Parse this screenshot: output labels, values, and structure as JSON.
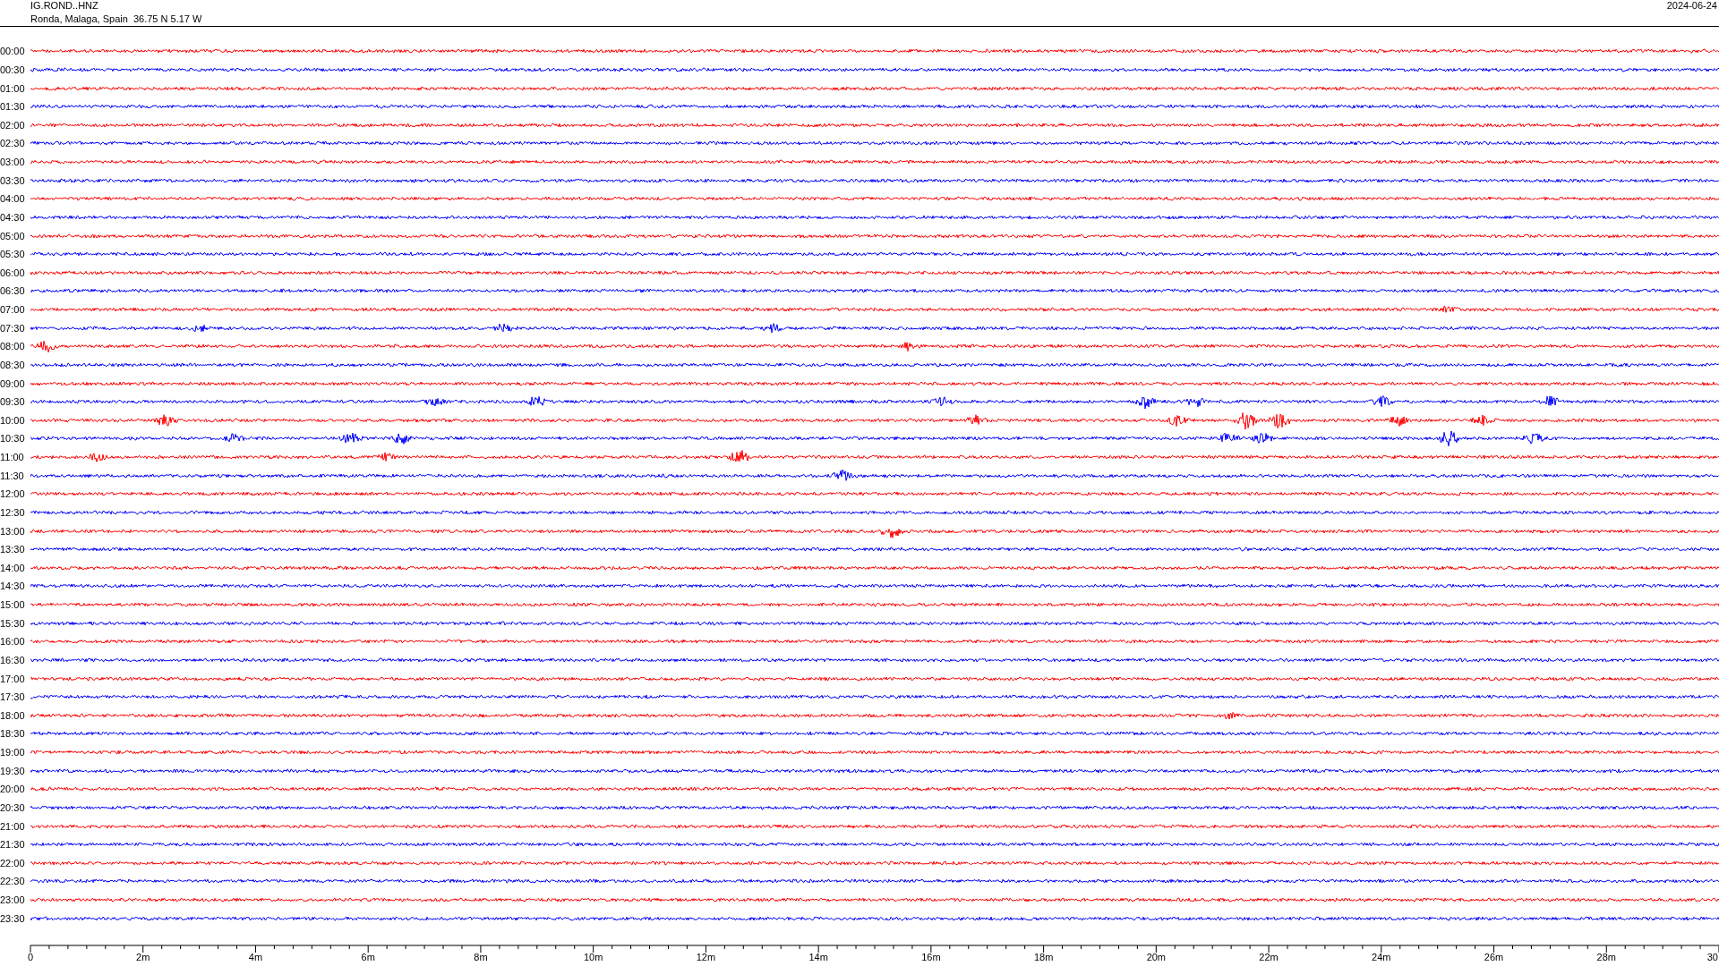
{
  "header": {
    "station": "IG.ROND..HNZ",
    "location": "Ronda, Malaga, Spain  36.75 N 5.17 W",
    "date": "2024-06-24"
  },
  "traces": [
    {
      "time": "00:00",
      "color": "#ff0000"
    },
    {
      "time": "00:30",
      "color": "#0000ff"
    },
    {
      "time": "01:00",
      "color": "#ff0000"
    },
    {
      "time": "01:30",
      "color": "#0000ff"
    },
    {
      "time": "02:00",
      "color": "#ff0000"
    },
    {
      "time": "02:30",
      "color": "#0000ff"
    },
    {
      "time": "03:00",
      "color": "#ff0000"
    },
    {
      "time": "03:30",
      "color": "#0000ff"
    },
    {
      "time": "04:00",
      "color": "#ff0000"
    },
    {
      "time": "04:30",
      "color": "#0000ff"
    },
    {
      "time": "05:00",
      "color": "#ff0000"
    },
    {
      "time": "05:30",
      "color": "#0000ff"
    },
    {
      "time": "06:00",
      "color": "#ff0000"
    },
    {
      "time": "06:30",
      "color": "#0000ff"
    },
    {
      "time": "07:00",
      "color": "#ff0000"
    },
    {
      "time": "07:30",
      "color": "#0000ff"
    },
    {
      "time": "08:00",
      "color": "#ff0000"
    },
    {
      "time": "08:30",
      "color": "#0000ff"
    },
    {
      "time": "09:00",
      "color": "#ff0000"
    },
    {
      "time": "09:30",
      "color": "#0000ff"
    },
    {
      "time": "10:00",
      "color": "#ff0000"
    },
    {
      "time": "10:30",
      "color": "#0000ff"
    },
    {
      "time": "11:00",
      "color": "#ff0000"
    },
    {
      "time": "11:30",
      "color": "#0000ff"
    },
    {
      "time": "12:00",
      "color": "#ff0000"
    },
    {
      "time": "12:30",
      "color": "#0000ff"
    },
    {
      "time": "13:00",
      "color": "#ff0000"
    },
    {
      "time": "13:30",
      "color": "#0000ff"
    },
    {
      "time": "14:00",
      "color": "#ff0000"
    },
    {
      "time": "14:30",
      "color": "#0000ff"
    },
    {
      "time": "15:00",
      "color": "#ff0000"
    },
    {
      "time": "15:30",
      "color": "#0000ff"
    },
    {
      "time": "16:00",
      "color": "#ff0000"
    },
    {
      "time": "16:30",
      "color": "#0000ff"
    },
    {
      "time": "17:00",
      "color": "#ff0000"
    },
    {
      "time": "17:30",
      "color": "#0000ff"
    },
    {
      "time": "18:00",
      "color": "#ff0000"
    },
    {
      "time": "18:30",
      "color": "#0000ff"
    },
    {
      "time": "19:00",
      "color": "#ff0000"
    },
    {
      "time": "19:30",
      "color": "#0000ff"
    },
    {
      "time": "20:00",
      "color": "#ff0000"
    },
    {
      "time": "20:30",
      "color": "#0000ff"
    },
    {
      "time": "21:00",
      "color": "#ff0000"
    },
    {
      "time": "21:30",
      "color": "#0000ff"
    },
    {
      "time": "22:00",
      "color": "#ff0000"
    },
    {
      "time": "22:30",
      "color": "#0000ff"
    },
    {
      "time": "23:00",
      "color": "#ff0000"
    },
    {
      "time": "23:30",
      "color": "#0000ff"
    }
  ],
  "axis": {
    "labels": [
      "0",
      "2m",
      "4m",
      "6m",
      "8m",
      "10m",
      "12m",
      "14m",
      "16m",
      "18m",
      "20m",
      "22m",
      "24m",
      "26m",
      "28m",
      "30"
    ]
  }
}
